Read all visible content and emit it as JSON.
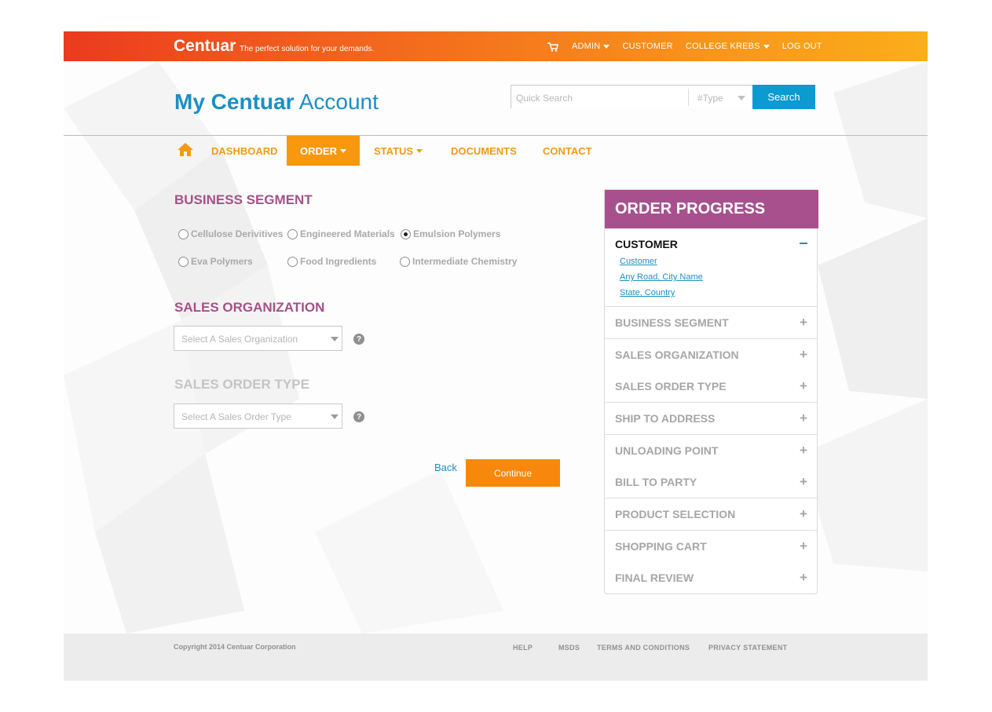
{
  "topbar": {
    "brand": "Centuar",
    "tagline": "The perfect solution for your demands.",
    "cart_icon": "cart-icon",
    "nav": [
      "ADMIN",
      "CUSTOMER",
      "COLLEGE KREBS",
      "LOG OUT"
    ]
  },
  "header": {
    "title_bold": "My Centuar",
    "title_light": "Account",
    "search_placeholder": "Quick Search",
    "type_placeholder": "#Type",
    "search_button": "Search"
  },
  "main_nav": {
    "home_icon": "home-icon",
    "items": [
      "DASHBOARD",
      "ORDER",
      "STATUS",
      "DOCUMENTS",
      "CONTACT"
    ],
    "active": "ORDER"
  },
  "form": {
    "business_segment": {
      "title": "BUSINESS SEGMENT",
      "options": [
        "Cellulose Derivitives",
        "Engineered Materials",
        "Emulsion Polymers",
        "Eva Polymers",
        "Food Ingredients",
        "Intermediate Chemistry"
      ],
      "selected": "Emulsion Polymers"
    },
    "sales_org": {
      "title": "SALES ORGANIZATION",
      "placeholder": "Select A Sales Organization"
    },
    "sales_order_type": {
      "title": "SALES ORDER TYPE",
      "placeholder": "Select A Sales Order Type"
    },
    "help_glyph": "?",
    "back_label": "Back",
    "continue_label": "Continue"
  },
  "order_progress": {
    "title": "ORDER PROGRESS",
    "customer": {
      "label": "CUSTOMER",
      "links": [
        "Customer",
        "Any Road, City Name",
        "State, Country"
      ]
    },
    "steps": [
      "BUSINESS SEGMENT",
      "SALES ORGANIZATION",
      "SALES ORDER TYPE",
      "SHIP TO ADDRESS",
      "UNLOADING POINT",
      "BILL TO PARTY",
      "PRODUCT SELECTION",
      "SHOPPING CART",
      "FINAL REVIEW"
    ],
    "expand_glyph": "+"
  },
  "footer": {
    "copyright": "Copyright 2014 Centuar Corporation",
    "links": [
      "HELP",
      "MSDS",
      "TERMS AND CONDITIONS",
      "PRIVACY STATEMENT"
    ]
  },
  "colors": {
    "topbar_start": "#ec3a1f",
    "topbar_end": "#fbae1a",
    "accent_blue": "#1b8fc4",
    "accent_orange": "#f7980e",
    "segment_purple": "#a8508e"
  }
}
